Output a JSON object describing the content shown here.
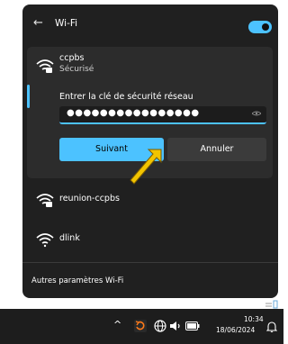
{
  "panel": {
    "back_glyph": "←",
    "title": "Wi-Fi",
    "toggle_state": "on"
  },
  "selected_network": {
    "name": "ccpbs",
    "status": "Sécurisé",
    "key_label": "Entrer la clé de sécurité réseau",
    "password_masked": "●●●●●●●●●●●●●●●●",
    "next_label": "Suivant",
    "cancel_label": "Annuler"
  },
  "networks": [
    {
      "name": "reunion-ccpbs",
      "secured": true
    },
    {
      "name": "dlink",
      "secured": false
    }
  ],
  "footer": {
    "label": "Autres paramètres Wi-Fi"
  },
  "taskbar": {
    "chevron": "^",
    "time": "10:34",
    "date": "18/06/2024"
  },
  "colors": {
    "accent": "#4cc2ff",
    "panel_bg": "#202020",
    "card_bg": "#2c2c2c",
    "cursor": "#f2c400"
  },
  "icons": [
    "back-arrow-icon",
    "wifi-icon",
    "wifi-secured-icon",
    "eye-icon",
    "mouse-cursor-icon",
    "refresh-icon",
    "globe-icon",
    "speaker-icon",
    "battery-icon",
    "notification-bell-icon"
  ]
}
